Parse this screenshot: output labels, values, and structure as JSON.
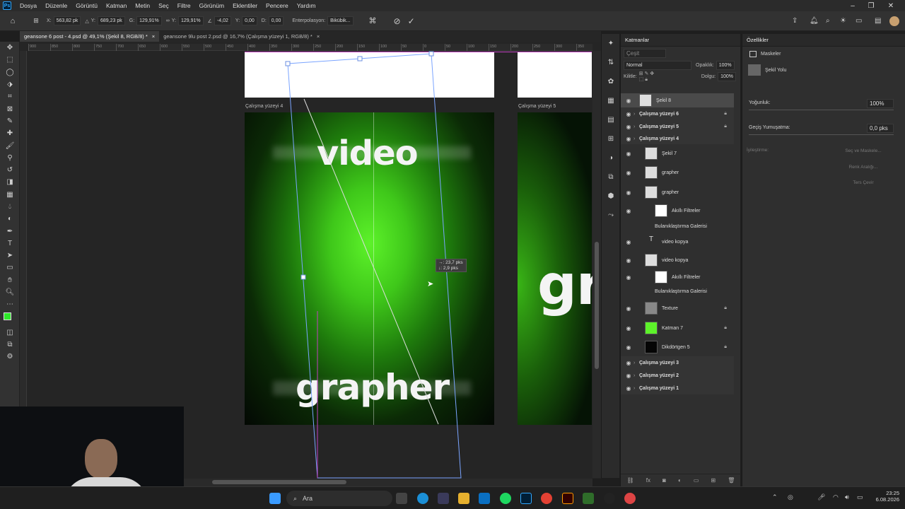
{
  "menu": {
    "app_icon": "Ps",
    "items": [
      "Dosya",
      "Düzenle",
      "Görüntü",
      "Katman",
      "Metin",
      "Seç",
      "Filtre",
      "Görünüm",
      "Eklentiler",
      "Pencere",
      "Yardım"
    ]
  },
  "options_bar": {
    "x_label": "X:",
    "x_value": "563,82 pk",
    "y_label": "Y:",
    "y_value": "689,23 pk",
    "w_label": "G:",
    "w_value": "129,91%",
    "h_label": "Y:",
    "h_value": "129,91%",
    "angle_value": "-4,02",
    "hskew_label": "Y:",
    "hskew_value": "0,00",
    "vskew_label": "D:",
    "vskew_value": "0,00",
    "interp_label": "Enterpolasyon:",
    "interp_value": "Bikübik..."
  },
  "tabs": [
    {
      "label": "geansone 6 post - 4.psd @ 49,1% (Şekil 8, RGB/8) *",
      "active": true
    },
    {
      "label": "geansone 9lu post 2.psd @ 16,7% (Çalışma yüzeyi 1, RGB/8) *",
      "active": false
    }
  ],
  "ruler_marks": [
    "900",
    "850",
    "800",
    "750",
    "700",
    "650",
    "600",
    "550",
    "500",
    "450",
    "400",
    "350",
    "300",
    "250",
    "200",
    "150",
    "100",
    "50",
    "0",
    "50",
    "100",
    "150",
    "200",
    "250",
    "300",
    "350",
    "400",
    "450",
    "500",
    "550",
    "600",
    "650",
    "700",
    "750",
    "800",
    "850",
    "900",
    "950",
    "1000",
    "1050",
    "1100",
    "1150",
    "1200",
    "1250",
    "1300",
    "1350",
    "1400",
    "1450",
    "1500",
    "1550",
    "1600",
    "1650",
    "1700",
    "1750",
    "1800"
  ],
  "artboards": {
    "label_4": "Çalışma yüzeyi 4",
    "label_5": "Çalışma yüzeyi 5",
    "text_top": "video",
    "text_bottom": "grapher",
    "text_right": "gr"
  },
  "transform_tooltip": {
    "line1": "→: 23,7 pks",
    "line2": "↓: 2,9 pks"
  },
  "layers_panel": {
    "title": "Katmanlar",
    "search_placeholder": "Çeşit",
    "blend_mode": "Normal",
    "opacity_label": "Opaklık:",
    "opacity_value": "100%",
    "lock_label": "Kilitle:",
    "fill_label": "Dolgu:",
    "fill_value": "100%",
    "layers": [
      {
        "name": "Şekil 8",
        "bold": false,
        "selected": true,
        "indent": 0
      },
      {
        "name": "Çalışma yüzeyi 6",
        "bold": true,
        "indent": 0,
        "locked": true
      },
      {
        "name": "Çalışma yüzeyi 5",
        "bold": true,
        "indent": 0,
        "locked": true
      },
      {
        "name": "Çalışma yüzeyi 4",
        "bold": true,
        "indent": 0
      },
      {
        "name": "Şekil 7",
        "indent": 1
      },
      {
        "name": "grapher",
        "indent": 1
      },
      {
        "name": "grapher",
        "indent": 1,
        "smart": true
      },
      {
        "name": "Akıllı Filtreler",
        "indent": 2
      },
      {
        "name": "Bulanıklaştırma Galerisi",
        "indent": 2
      },
      {
        "name": "video kopya",
        "indent": 1,
        "type": "text"
      },
      {
        "name": "video kopya",
        "indent": 1,
        "smart": true
      },
      {
        "name": "Akıllı Filtreler",
        "indent": 2
      },
      {
        "name": "Bulanıklaştırma Galerisi",
        "indent": 2
      },
      {
        "name": "Texture",
        "indent": 1,
        "locked": true
      },
      {
        "name": "Katman 7",
        "indent": 1,
        "locked": true
      },
      {
        "name": "Dikdörtgen 5",
        "indent": 1,
        "locked": true
      },
      {
        "name": "Çalışma yüzeyi 3",
        "bold": true,
        "indent": 0
      },
      {
        "name": "Çalışma yüzeyi 2",
        "bold": true,
        "indent": 0
      },
      {
        "name": "Çalışma yüzeyi 1",
        "bold": true,
        "indent": 0
      }
    ]
  },
  "properties_panel": {
    "title": "Özellikler",
    "section": "Maskeler",
    "item": "Şekil Yolu",
    "density_label": "Yoğunluk:",
    "density_value": "100%",
    "feather_label": "Geçiş Yumuşatma:",
    "feather_value": "0,0 pks",
    "refine_label": "İyileştirme:",
    "btn_select_mask": "Seç ve Maskele...",
    "btn_color_range": "Renk Aralığı...",
    "btn_invert": "Ters Çevir"
  },
  "taskbar": {
    "search_label": "Ara",
    "time": "23:25",
    "date": "6.08.2026"
  },
  "colors": {
    "accent_green": "#5df22a",
    "app_bg": "#1e1e1e",
    "panel_bg": "#2f2f2f",
    "ps_blue": "#31a8ff"
  }
}
